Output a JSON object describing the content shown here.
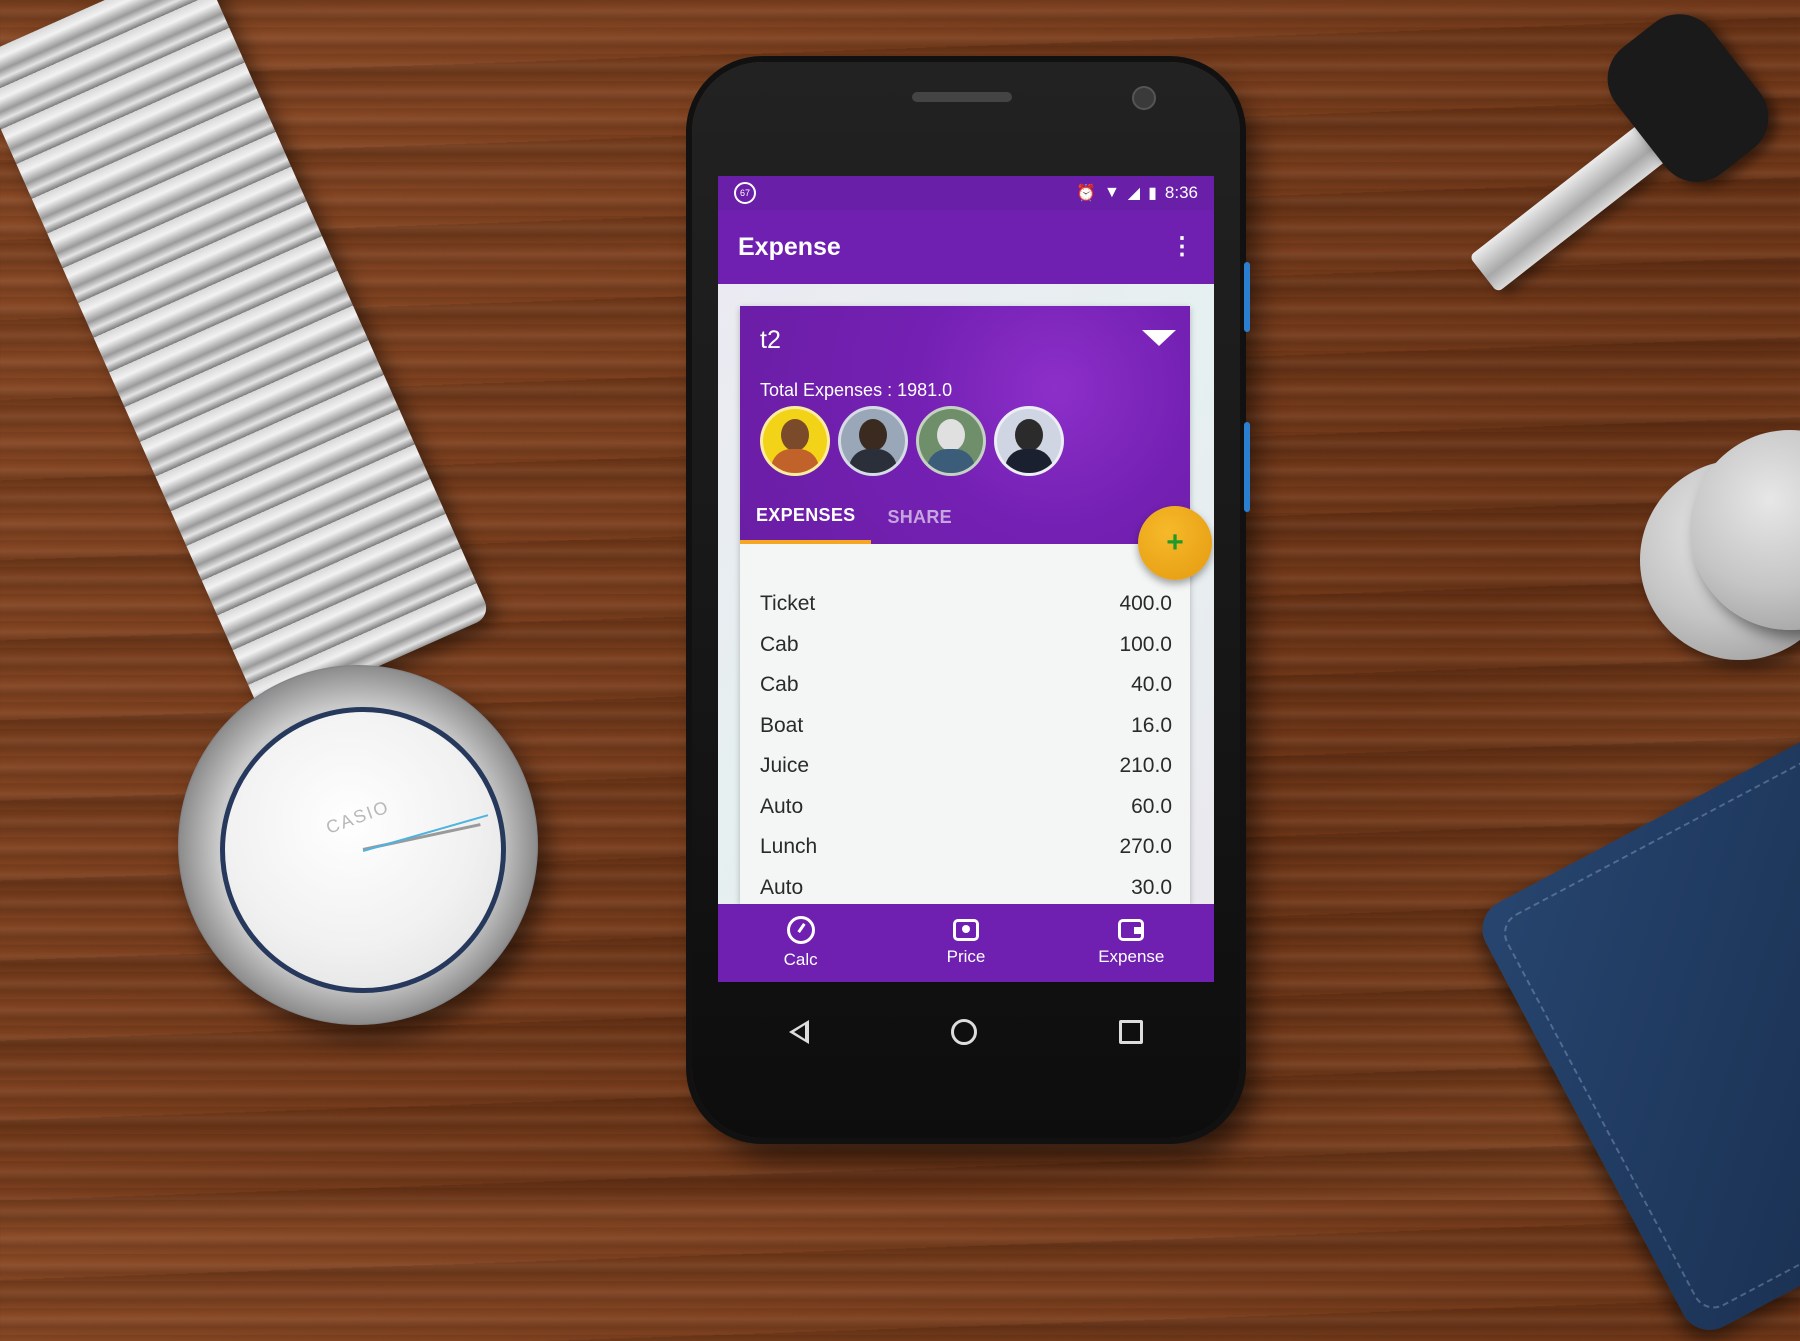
{
  "status_bar": {
    "notification_badge": "67",
    "time": "8:36",
    "icons": [
      "alarm-icon",
      "wifi-icon",
      "signal-icon",
      "battery-icon"
    ]
  },
  "app_bar": {
    "title": "Expense",
    "overflow_icon": "more-vert-icon"
  },
  "group": {
    "name": "t2",
    "total_label": "Total Expenses : 1981.0",
    "members": [
      "avatar-1",
      "avatar-2",
      "avatar-3",
      "avatar-4"
    ]
  },
  "tabs": [
    {
      "label": "EXPENSES",
      "active": true
    },
    {
      "label": "SHARE",
      "active": false
    }
  ],
  "fab": {
    "label": "+"
  },
  "expenses": [
    {
      "name": "Ticket",
      "amount": "400.0"
    },
    {
      "name": "Cab",
      "amount": "100.0"
    },
    {
      "name": "Cab",
      "amount": "40.0"
    },
    {
      "name": "Boat",
      "amount": "16.0"
    },
    {
      "name": "Juice",
      "amount": "210.0"
    },
    {
      "name": "Auto",
      "amount": "60.0"
    },
    {
      "name": "Lunch",
      "amount": "270.0"
    },
    {
      "name": "Auto",
      "amount": "30.0"
    }
  ],
  "bottom_nav": [
    {
      "label": "Calc",
      "icon": "speedometer-icon"
    },
    {
      "label": "Price",
      "icon": "money-icon"
    },
    {
      "label": "Expense",
      "icon": "wallet-icon"
    }
  ],
  "watch": {
    "brand": "CASIO"
  },
  "colors": {
    "primary": "#6f20b0",
    "accent": "#f5a623",
    "fab": "#e59a10"
  }
}
